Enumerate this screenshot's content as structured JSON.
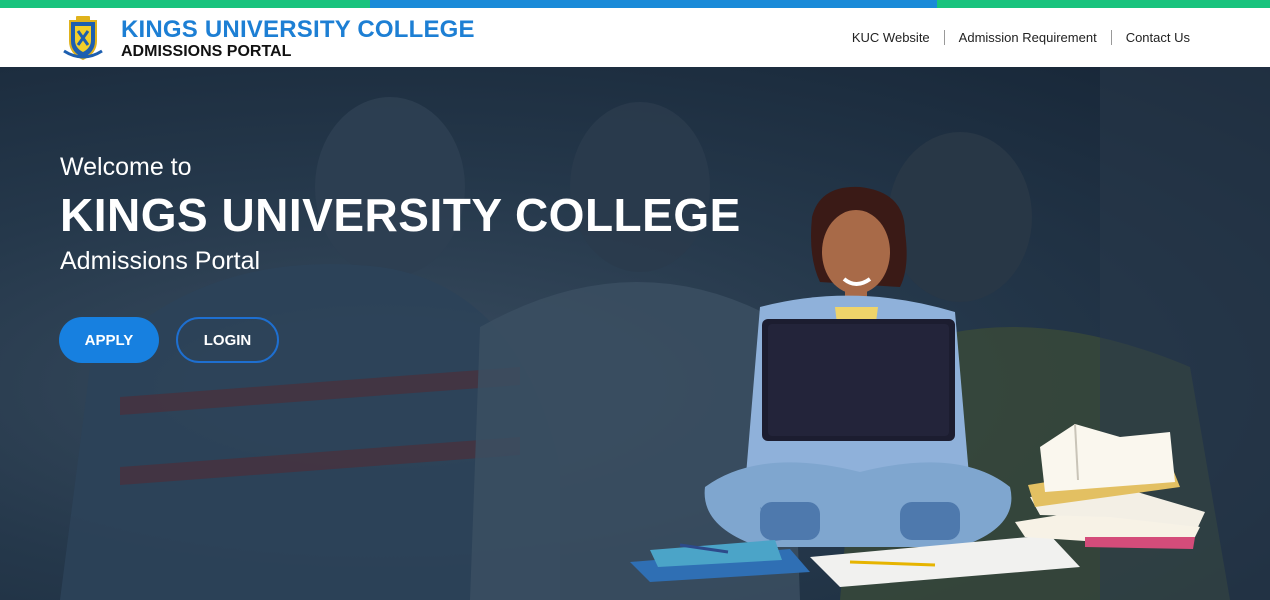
{
  "header": {
    "title": "KINGS UNIVERSITY COLLEGE",
    "subtitle": "ADMISSIONS PORTAL",
    "logo_icon": "crest-logo-icon"
  },
  "nav": {
    "items": [
      {
        "label": "KUC Website"
      },
      {
        "label": "Admission Requirement"
      },
      {
        "label": "Contact Us"
      }
    ]
  },
  "hero": {
    "welcome": "Welcome to",
    "college": "KINGS UNIVERSITY COLLEGE",
    "portal": "Admissions Portal",
    "apply_label": "APPLY",
    "login_label": "LOGIN"
  },
  "colors": {
    "brand_blue": "#1d7fd4",
    "apply_button": "#1780e0",
    "top_green": "#19c37d",
    "top_blue": "#1a8ad8"
  }
}
